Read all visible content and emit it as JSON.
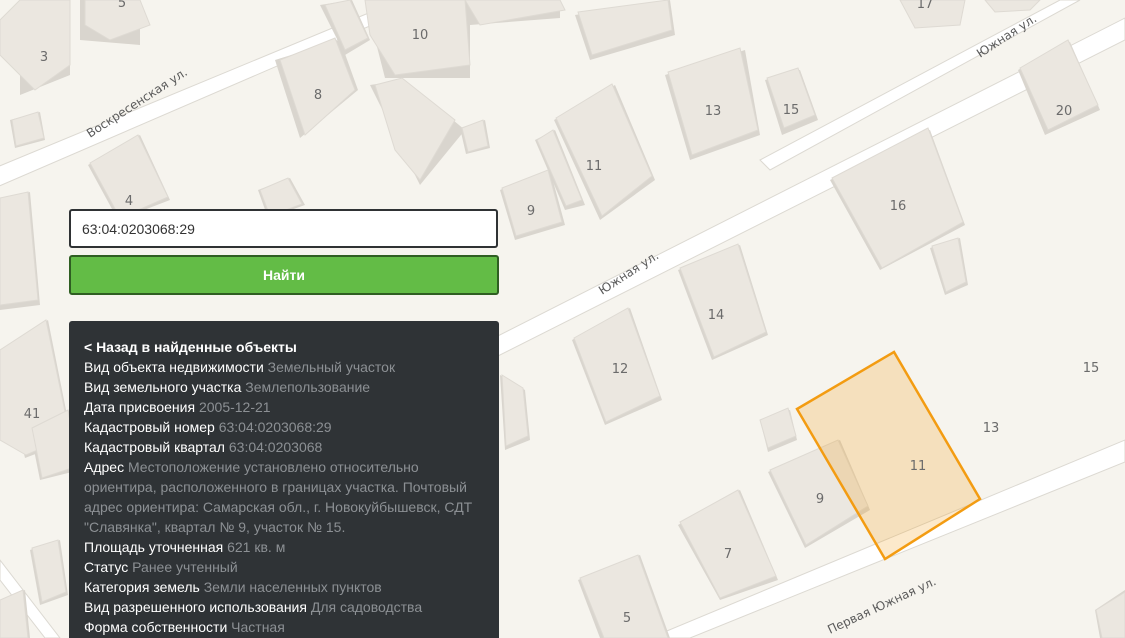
{
  "search": {
    "value": "63:04:0203068:29",
    "button_label": "Найти"
  },
  "map": {
    "streets": {
      "voskresenskaya": "Воскресенская ул.",
      "yuzhnaya_center": "Южная ул.",
      "yuzhnaya_top": "Южная ул.",
      "pervaya_yuzhnaya": "Первая Южная ул."
    },
    "house_numbers": {
      "n3": "3",
      "n5": "5",
      "n10": "10",
      "n8": "8",
      "n4": "4",
      "n17": "17",
      "n13a": "13",
      "n15a": "15",
      "n20": "20",
      "n11a": "11",
      "n9a": "9",
      "n16": "16",
      "n14": "14",
      "n12": "12",
      "n41": "41",
      "n15b": "15",
      "n13b": "13",
      "n11b": "11",
      "n9b": "9",
      "n7": "7",
      "n5b": "5"
    },
    "parcel_color": "#f39c12"
  },
  "panel": {
    "back_label": "< Назад в найденные объекты",
    "rows": [
      {
        "key": "Вид объекта недвижимости",
        "value": "Земельный участок"
      },
      {
        "key": "Вид земельного участка",
        "value": "Землепользование"
      },
      {
        "key": "Дата присвоения",
        "value": "2005-12-21"
      },
      {
        "key": "Кадастровый номер",
        "value": "63:04:0203068:29"
      },
      {
        "key": "Кадастровый квартал",
        "value": "63:04:0203068"
      },
      {
        "key": "Адрес",
        "value": "Местоположение установлено относительно ориентира, расположенного в границах участка. Почтовый адрес ориентира: Самарская обл., г. Новокуйбышевск, СДТ \"Славянка\", квартал № 9, участок № 15."
      },
      {
        "key": "Площадь уточненная",
        "value": "621 кв. м"
      },
      {
        "key": "Статус",
        "value": "Ранее учтенный"
      },
      {
        "key": "Категория земель",
        "value": "Земли населенных пунктов"
      },
      {
        "key": "Вид разрешенного использования",
        "value": "Для садоводства"
      },
      {
        "key": "Форма собственности",
        "value": "Частная"
      }
    ]
  }
}
